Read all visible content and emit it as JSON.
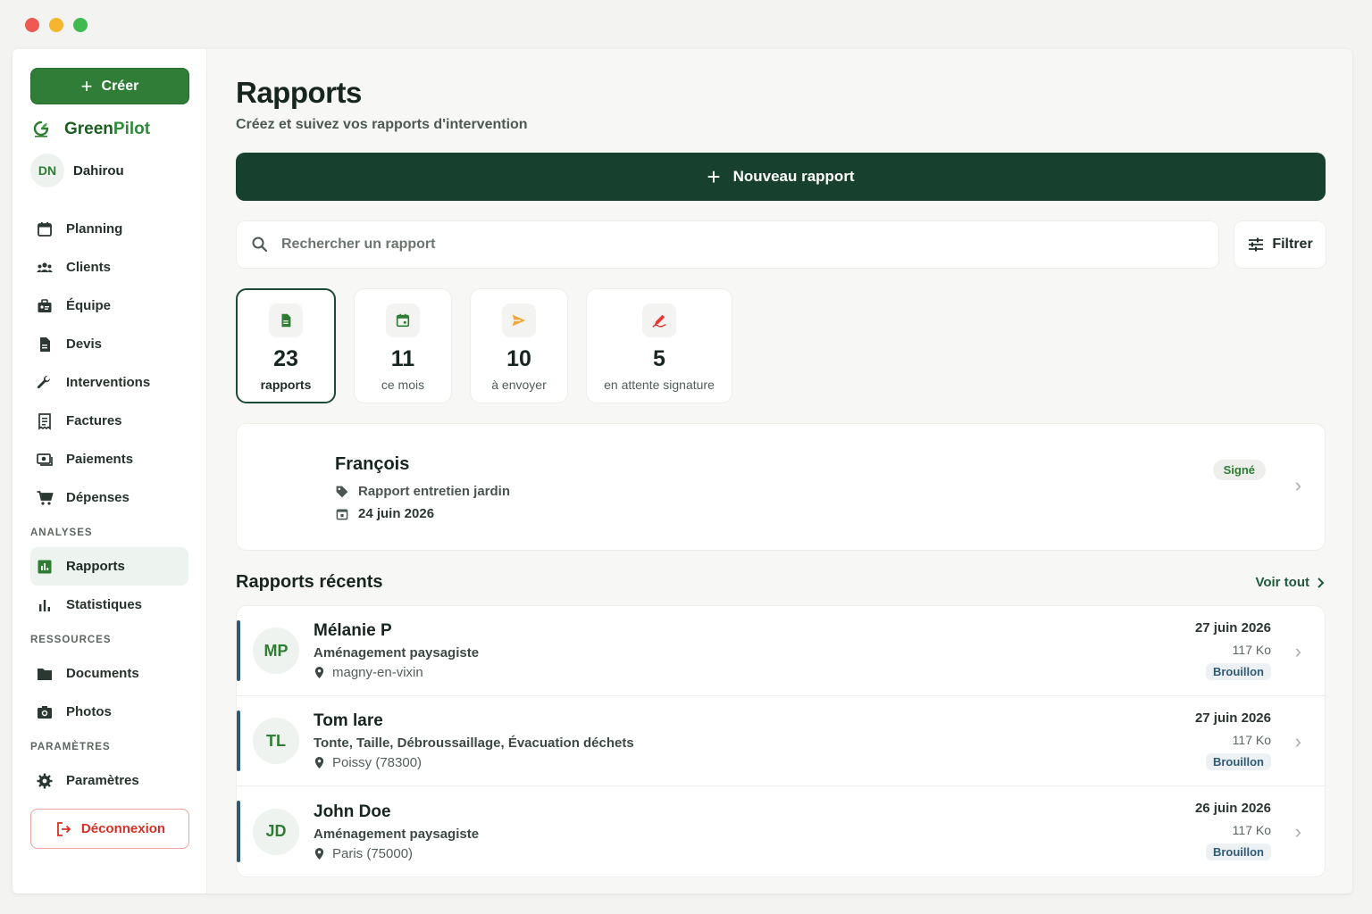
{
  "window": {
    "controls": [
      "close",
      "minimize",
      "maximize"
    ]
  },
  "sidebar": {
    "create_label": "Créer",
    "brand": {
      "part1": "Green",
      "part2": "Pilot"
    },
    "user": {
      "initials": "DN",
      "name": "Dahirou"
    },
    "items_main": [
      {
        "label": "Planning",
        "icon": "calendar-icon"
      },
      {
        "label": "Clients",
        "icon": "users-icon"
      },
      {
        "label": "Équipe",
        "icon": "team-icon"
      },
      {
        "label": "Devis",
        "icon": "document-icon"
      },
      {
        "label": "Interventions",
        "icon": "wrench-icon"
      },
      {
        "label": "Factures",
        "icon": "receipt-icon"
      },
      {
        "label": "Paiements",
        "icon": "payment-icon"
      },
      {
        "label": "Dépenses",
        "icon": "cart-icon"
      }
    ],
    "section_analyses": "ANALYSES",
    "items_analyses": [
      {
        "label": "Rapports",
        "icon": "report-chart-icon",
        "active": true
      },
      {
        "label": "Statistiques",
        "icon": "bar-chart-icon"
      }
    ],
    "section_ressources": "RESSOURCES",
    "items_ressources": [
      {
        "label": "Documents",
        "icon": "folder-icon"
      },
      {
        "label": "Photos",
        "icon": "camera-icon"
      }
    ],
    "section_parametres": "PARAMÈTRES",
    "items_parametres": [
      {
        "label": "Paramètres",
        "icon": "gear-icon"
      }
    ],
    "logout_label": "Déconnexion"
  },
  "main": {
    "title": "Rapports",
    "subtitle": "Créez et suivez vos rapports d'intervention",
    "new_report_label": "Nouveau rapport",
    "search_placeholder": "Rechercher un rapport",
    "filter_label": "Filtrer",
    "stats": [
      {
        "value": "23",
        "label": "rapports",
        "icon": "file-icon",
        "active": true
      },
      {
        "value": "11",
        "label": "ce mois",
        "icon": "calendar-icon"
      },
      {
        "value": "10",
        "label": "à envoyer",
        "icon": "send-icon"
      },
      {
        "value": "5",
        "label": "en attente signature",
        "icon": "signature-icon"
      }
    ],
    "featured": {
      "name": "François",
      "type": "Rapport entretien jardin",
      "date": "24 juin 2026",
      "status": "Signé"
    },
    "recent_title": "Rapports récents",
    "see_all_label": "Voir tout",
    "recent": [
      {
        "initials": "MP",
        "name": "Mélanie P",
        "type": "Aménagement paysagiste",
        "location": "magny-en-vixin",
        "date": "27 juin 2026",
        "size": "117 Ko",
        "status": "Brouillon"
      },
      {
        "initials": "TL",
        "name": "Tom lare",
        "type": "Tonte, Taille, Débroussaillage, Évacuation déchets",
        "location": "Poissy (78300)",
        "date": "27 juin 2026",
        "size": "117 Ko",
        "status": "Brouillon"
      },
      {
        "initials": "JD",
        "name": "John Doe",
        "type": "Aménagement paysagiste",
        "location": "Paris (75000)",
        "date": "26 juin 2026",
        "size": "117 Ko",
        "status": "Brouillon"
      }
    ]
  },
  "colors": {
    "accent": "#2f7d37",
    "dark_green": "#17412e",
    "logout_red": "#d93025",
    "draft_blue": "#2e5a78"
  }
}
